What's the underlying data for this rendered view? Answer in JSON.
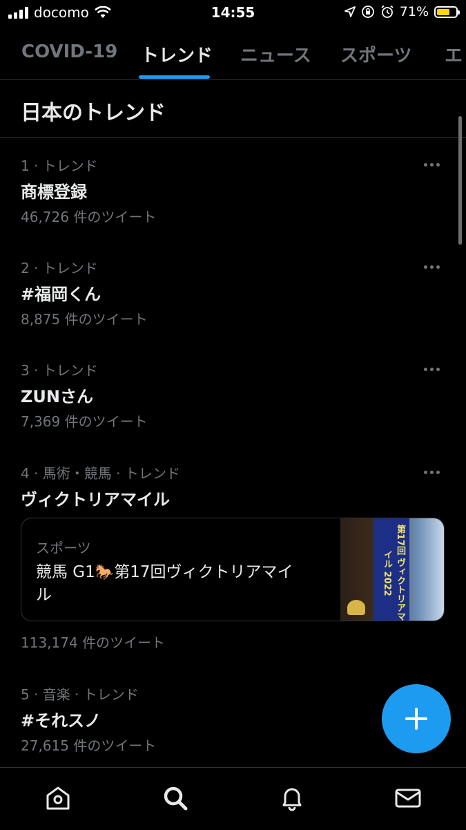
{
  "status_bar": {
    "carrier": "docomo",
    "time": "14:55",
    "battery_percent": "71%",
    "battery_level": 0.71,
    "battery_color": "#ffd60a"
  },
  "tabs": [
    {
      "label": "COVID-19",
      "active": false
    },
    {
      "label": "トレンド",
      "active": true
    },
    {
      "label": "ニュース",
      "active": false
    },
    {
      "label": "スポーツ",
      "active": false
    },
    {
      "label": "エ",
      "active": false
    }
  ],
  "accent_color": "#1d9bf0",
  "section_title": "日本のトレンド",
  "trends": [
    {
      "meta": "1 · トレンド",
      "name": "商標登録",
      "count": "46,726 件のツイート"
    },
    {
      "meta": "2 · トレンド",
      "name": "#福岡くん",
      "count": "8,875 件のツイート"
    },
    {
      "meta": "3 · トレンド",
      "name": "ZUNさん",
      "count": "7,369 件のツイート"
    },
    {
      "meta": "4 · 馬術・競馬 · トレンド",
      "name": "ヴィクトリアマイル",
      "count": "113,174 件のツイート",
      "card": {
        "category": "スポーツ",
        "title_before": "競馬 G1",
        "title_after": "第17回ヴィクトリアマイル",
        "image_text": "第17回 ヴィクトリアマイル 2022"
      }
    },
    {
      "meta": "5 · 音楽 · トレンド",
      "name": "#それスノ",
      "count": "27,615 件のツイート"
    }
  ],
  "icons": {
    "more": "more-options-icon",
    "compose": "plus-icon",
    "nav": [
      "home-icon",
      "search-icon",
      "bell-icon",
      "mail-icon"
    ]
  }
}
